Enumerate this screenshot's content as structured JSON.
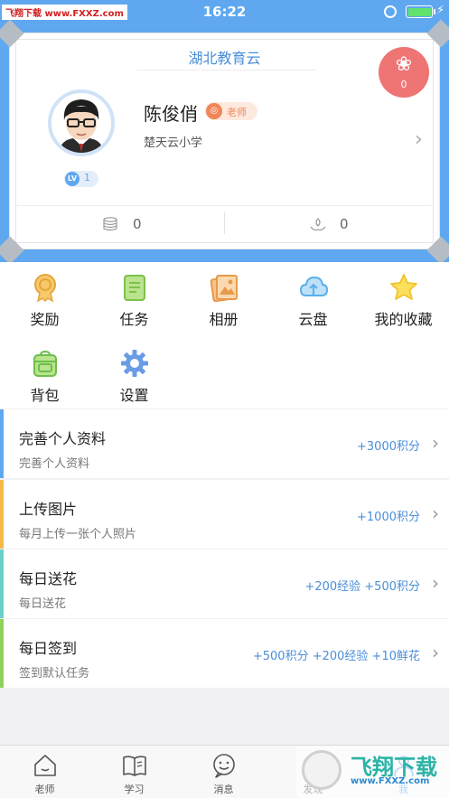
{
  "status_bar": {
    "time": "16:22",
    "watermark": "飞翔下载 www.FXXZ.com"
  },
  "profile_card": {
    "title": "湖北教育云",
    "flower_count": "0",
    "user_name": "陈俊俏",
    "role": "老师",
    "school": "楚天云小学",
    "level_tag": "LV",
    "level": "1",
    "coins": "0",
    "flowers_received": "0"
  },
  "menu": {
    "rewards": "奖励",
    "tasks": "任务",
    "album": "相册",
    "cloud_drive": "云盘",
    "favorites": "我的收藏",
    "backpack": "背包",
    "settings": "设置"
  },
  "task_list": [
    {
      "title": "完善个人资料",
      "subtitle": "完善个人资料",
      "reward": "+3000积分",
      "accent": "#5fa8f0"
    },
    {
      "title": "上传图片",
      "subtitle": "每月上传一张个人照片",
      "reward": "+1000积分",
      "accent": "#f5b94a"
    },
    {
      "title": "每日送花",
      "subtitle": "每日送花",
      "reward": "+200经验 +500积分",
      "accent": "#6ccfc8"
    },
    {
      "title": "每日签到",
      "subtitle": "签到默认任务",
      "reward": "+500积分 +200经验 +10鲜花",
      "accent": "#8fd25c"
    }
  ],
  "tab_bar": {
    "teacher": "老师",
    "study": "学习",
    "messages": "消息",
    "discover": "发现",
    "me": "我"
  },
  "watermark": {
    "brand": "飞翔下载",
    "url": "www.FXXZ.com"
  },
  "colors": {
    "primary": "#5fa8f0",
    "flower_badge": "#ef7474",
    "teacher_badge": "#f0865a"
  }
}
